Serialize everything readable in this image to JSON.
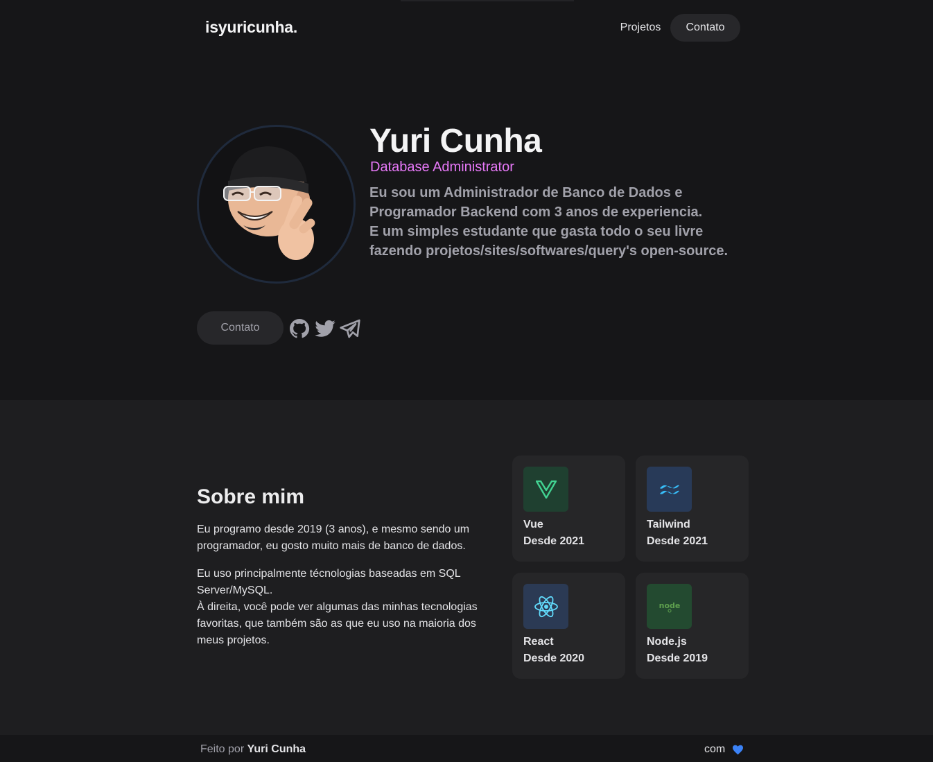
{
  "header": {
    "logo": "isyuricunha.",
    "nav": [
      {
        "label": "Projetos"
      },
      {
        "label": "Contato"
      }
    ]
  },
  "hero": {
    "name": "Yuri Cunha",
    "role": "Database Administrator",
    "bio_lines": [
      "Eu sou um Administrador de Banco de Dados e",
      "Programador Backend com 3 anos de experiencia.",
      "E um simples estudante que gasta todo o seu livre",
      "fazendo projetos/sites/softwares/query's open-source."
    ],
    "contact_button": "Contato",
    "social_icons": [
      "github-icon",
      "twitter-icon",
      "telegram-icon"
    ]
  },
  "about": {
    "title": "Sobre mim",
    "paragraph1": "Eu programo desde 2019 (3 anos), e mesmo sendo um programador, eu gosto muito mais de banco de dados.",
    "paragraph2_lines": [
      "Eu uso principalmente técnologias baseadas em SQL Server/MySQL.",
      "À direita, você pode ver algumas das minhas tecnologias favoritas, que também são as que eu uso na maioria dos meus projetos."
    ],
    "technologies": [
      {
        "name": "Vue",
        "since": "Desde 2021",
        "icon": "vue-icon",
        "color": "#42d392"
      },
      {
        "name": "Tailwind",
        "since": "Desde 2021",
        "icon": "tailwind-icon",
        "color": "#38bdf8"
      },
      {
        "name": "React",
        "since": "Desde 2020",
        "icon": "react-icon",
        "color": "#61dafb"
      },
      {
        "name": "Node.js",
        "since": "Desde 2019",
        "icon": "nodejs-icon",
        "color": "#5fa04e"
      }
    ]
  },
  "footer": {
    "made_by_prefix": "Feito por",
    "made_by_name": "Yuri Cunha",
    "with_label": "com",
    "heart_color": "#3b82f6"
  },
  "colors": {
    "background": "#161618",
    "section_background": "#1e1e20",
    "accent": "#e879f9",
    "muted_text": "#a1a1aa"
  }
}
